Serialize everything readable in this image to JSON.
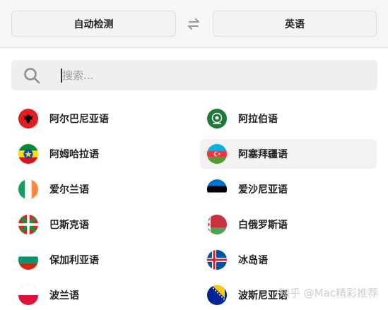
{
  "header": {
    "source_language": "自动检测",
    "target_language": "英语"
  },
  "search": {
    "placeholder": "搜索..."
  },
  "languages": [
    {
      "label": "阿尔巴尼亚语",
      "flag": "albania-flag-icon"
    },
    {
      "label": "阿拉伯语",
      "flag": "arab-league-flag-icon"
    },
    {
      "label": "阿姆哈拉语",
      "flag": "ethiopia-flag-icon"
    },
    {
      "label": "阿塞拜疆语",
      "flag": "azerbaijan-flag-icon",
      "selected": true
    },
    {
      "label": "爱尔兰语",
      "flag": "ireland-flag-icon"
    },
    {
      "label": "爱沙尼亚语",
      "flag": "estonia-flag-icon"
    },
    {
      "label": "巴斯克语",
      "flag": "basque-flag-icon"
    },
    {
      "label": "白俄罗斯语",
      "flag": "belarus-flag-icon"
    },
    {
      "label": "保加利亚语",
      "flag": "bulgaria-flag-icon"
    },
    {
      "label": "冰岛语",
      "flag": "iceland-flag-icon"
    },
    {
      "label": "波兰语",
      "flag": "poland-flag-icon"
    },
    {
      "label": "波斯尼亚语",
      "flag": "bosnia-flag-icon"
    }
  ],
  "watermark": "知乎 @Mac精彩推荐"
}
